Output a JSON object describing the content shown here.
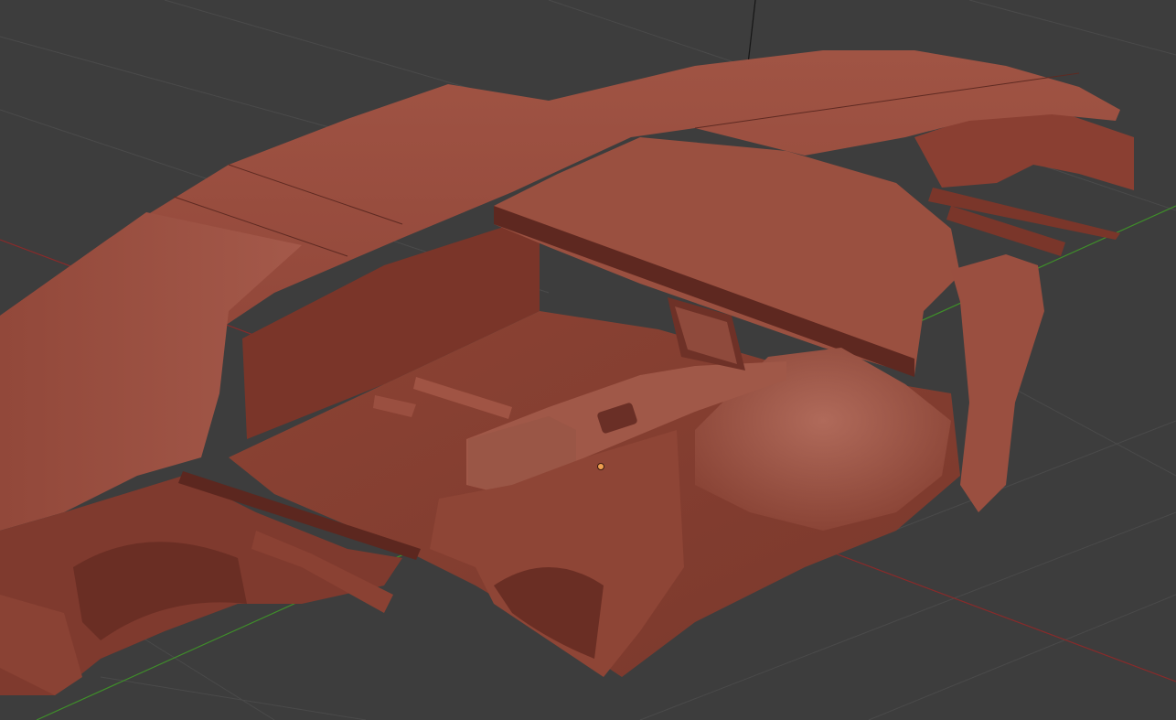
{
  "app": "3D viewport",
  "viewport": {
    "background_color": "#3d3d3d",
    "grid_color": "#4a4a4a",
    "axis_x_color": "#8a2a2a",
    "axis_y_color": "#3f8f2a",
    "axis_z_color": "#1a1a1a",
    "model_base_color": "#8a3f32",
    "origin_marker_color": "#f0a050"
  },
  "scene": {
    "model": "car-body-shell",
    "shading": "solid"
  }
}
